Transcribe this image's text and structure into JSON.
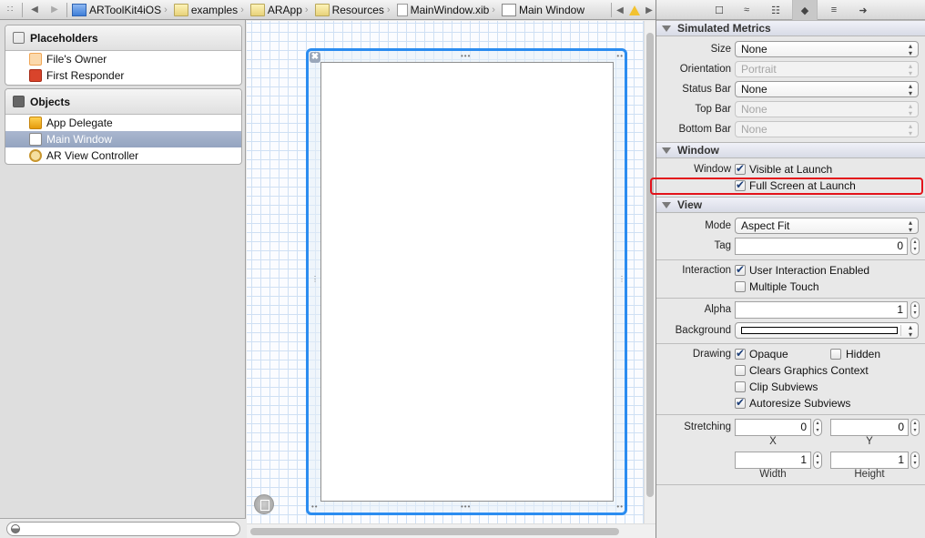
{
  "jumpbar": {
    "crumbs": [
      {
        "label": "ARToolKit4iOS",
        "icon": "xcode-project-icon"
      },
      {
        "label": "examples",
        "icon": "folder-icon"
      },
      {
        "label": "ARApp",
        "icon": "folder-icon"
      },
      {
        "label": "Resources",
        "icon": "folder-icon"
      },
      {
        "label": "MainWindow.xib",
        "icon": "xib-file-icon"
      },
      {
        "label": "Main Window",
        "icon": "window-icon"
      }
    ],
    "glyphs": {
      "grid": "∷",
      "back": "◀",
      "forward": "▶",
      "chevron": "›",
      "issue_prev": "◀",
      "issue_next": "▶"
    }
  },
  "outline": {
    "placeholders": {
      "title": "Placeholders",
      "items": [
        {
          "label": "File's Owner"
        },
        {
          "label": "First Responder"
        }
      ]
    },
    "objects": {
      "title": "Objects",
      "items": [
        {
          "label": "App Delegate"
        },
        {
          "label": "Main Window",
          "selected": true
        },
        {
          "label": "AR View Controller"
        }
      ]
    },
    "filter_placeholder": ""
  },
  "canvas": {
    "close_glyph": "✖",
    "handle_h": "•••",
    "handle_corner": "••"
  },
  "inspector": {
    "tab_glyphs": [
      "☐",
      "≈",
      "☷",
      "◆",
      "≡",
      "➜"
    ],
    "active_tab_index": 3,
    "simulated_metrics": {
      "title": "Simulated Metrics",
      "size": {
        "label": "Size",
        "value": "None"
      },
      "orientation": {
        "label": "Orientation",
        "value": "Portrait"
      },
      "status_bar": {
        "label": "Status Bar",
        "value": "None"
      },
      "top_bar": {
        "label": "Top Bar",
        "value": "None"
      },
      "bottom_bar": {
        "label": "Bottom Bar",
        "value": "None"
      }
    },
    "window": {
      "title": "Window",
      "label": "Window",
      "visible_at_launch": {
        "label": "Visible at Launch",
        "checked": true
      },
      "full_screen_at_launch": {
        "label": "Full Screen at Launch",
        "checked": true
      }
    },
    "view": {
      "title": "View",
      "mode": {
        "label": "Mode",
        "value": "Aspect Fit"
      },
      "tag": {
        "label": "Tag",
        "value": "0"
      },
      "interaction_label": "Interaction",
      "user_interaction": {
        "label": "User Interaction Enabled",
        "checked": true
      },
      "multiple_touch": {
        "label": "Multiple Touch",
        "checked": false
      },
      "alpha": {
        "label": "Alpha",
        "value": "1"
      },
      "background": {
        "label": "Background",
        "color": "#ffffff"
      },
      "drawing_label": "Drawing",
      "opaque": {
        "label": "Opaque",
        "checked": true
      },
      "hidden": {
        "label": "Hidden",
        "checked": false
      },
      "clears_graphics": {
        "label": "Clears Graphics Context",
        "checked": false
      },
      "clip_subviews": {
        "label": "Clip Subviews",
        "checked": false
      },
      "autoresize_subviews": {
        "label": "Autoresize Subviews",
        "checked": true
      },
      "stretching": {
        "label": "Stretching",
        "x": {
          "label": "X",
          "value": "0"
        },
        "y": {
          "label": "Y",
          "value": "0"
        },
        "width": {
          "label": "Width",
          "value": "1"
        },
        "height": {
          "label": "Height",
          "value": "1"
        }
      }
    },
    "popup_arrows": "▴▾",
    "stepper_arrows": "▴▾"
  },
  "colors": {
    "selection_frame": "#2b8cf0",
    "highlight_annotation": "#e3131b",
    "checkbox_mark": "#1d3f79"
  }
}
